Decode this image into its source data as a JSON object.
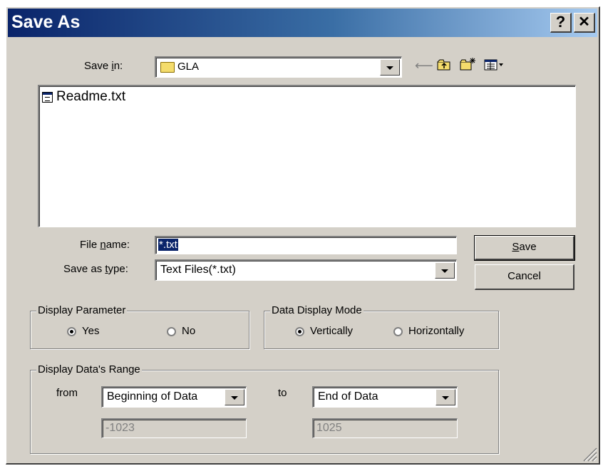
{
  "dialog": {
    "title": "Save As",
    "help_label": "?",
    "close_label": "✕"
  },
  "save_in": {
    "label_pre": "Save ",
    "label_mnemonic": "i",
    "label_post": "n:",
    "value": "GLA",
    "toolbar_icons": [
      "back-arrow-icon",
      "up-one-level-icon",
      "new-folder-icon",
      "view-menu-icon"
    ]
  },
  "files": [
    {
      "name": "Readme.txt",
      "icon": "text-file-icon"
    }
  ],
  "file_name": {
    "label_pre": "File ",
    "label_mnemonic": "n",
    "label_post": "ame:",
    "value": "*.txt"
  },
  "save_as_type": {
    "label_pre": "Save as ",
    "label_mnemonic": "t",
    "label_post": "ype:",
    "value": "Text Files(*.txt)"
  },
  "buttons": {
    "save_mnemonic": "S",
    "save_rest": "ave",
    "cancel": "Cancel"
  },
  "display_parameter": {
    "title": "Display Parameter",
    "options": [
      "Yes",
      "No"
    ],
    "selected": "Yes"
  },
  "data_display_mode": {
    "title": "Data Display Mode",
    "options": [
      "Vertically",
      "Horizontally"
    ],
    "selected": "Vertically"
  },
  "range": {
    "title": "Display Data's Range",
    "from_label": "from",
    "from_value": "Beginning of Data",
    "from_number": "-1023",
    "to_label": "to",
    "to_value": "End of Data",
    "to_number": "1025"
  }
}
